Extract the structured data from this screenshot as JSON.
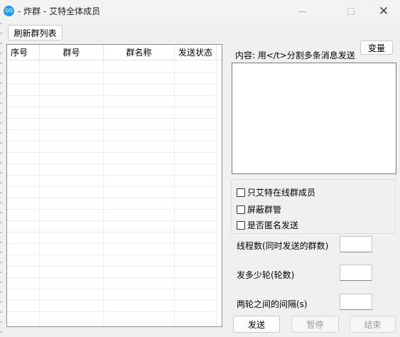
{
  "window": {
    "title": "- 炸群 - 艾特全体成员",
    "app_icon_text": "QQ",
    "close_glyph": "✕"
  },
  "toolbar": {
    "refresh_label": "刷新群列表"
  },
  "table": {
    "columns": [
      "序号",
      "群号",
      "群名称",
      "发送状态"
    ],
    "rows": []
  },
  "content": {
    "label": "内容: 用</t>分割多条消息发送",
    "variable_button": "变量",
    "value": ""
  },
  "options": {
    "only_online": "只艾特在线群成员",
    "block_admins": "屏蔽群管",
    "anonymous": "是否匿名发送",
    "only_online_checked": false,
    "block_admins_checked": false,
    "anonymous_checked": false
  },
  "settings": {
    "threads_label": "线程数(同时发送的群数)",
    "threads_value": "",
    "rounds_label": "发多少轮(轮数)",
    "rounds_value": "",
    "interval_label": "两轮之间的间隔(s)",
    "interval_value": ""
  },
  "actions": {
    "send": "发送",
    "pause": "暂停",
    "stop": "结束"
  }
}
